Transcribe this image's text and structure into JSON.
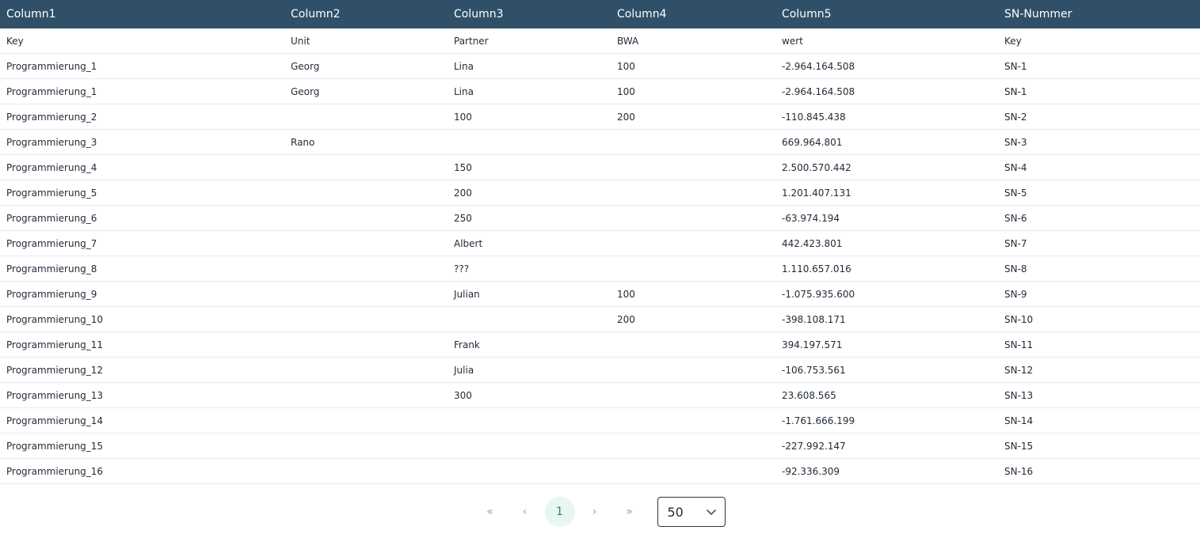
{
  "table": {
    "columns": [
      "Column1",
      "Column2",
      "Column3",
      "Column4",
      "Column5",
      "SN-Nummer"
    ],
    "rows": [
      [
        "Key",
        "Unit",
        "Partner",
        "BWA",
        "wert",
        "Key"
      ],
      [
        "Programmierung_1",
        "Georg",
        "Lina",
        "100",
        "-2.964.164.508",
        "SN-1"
      ],
      [
        "Programmierung_1",
        "Georg",
        "Lina",
        "100",
        "-2.964.164.508",
        "SN-1"
      ],
      [
        "Programmierung_2",
        "",
        "100",
        "200",
        "-110.845.438",
        "SN-2"
      ],
      [
        "Programmierung_3",
        "Rano",
        "",
        "",
        "669.964.801",
        "SN-3"
      ],
      [
        "Programmierung_4",
        "",
        "150",
        "",
        "2.500.570.442",
        "SN-4"
      ],
      [
        "Programmierung_5",
        "",
        "200",
        "",
        "1.201.407.131",
        "SN-5"
      ],
      [
        "Programmierung_6",
        "",
        "250",
        "",
        "-63.974.194",
        "SN-6"
      ],
      [
        "Programmierung_7",
        "",
        "Albert",
        "",
        "442.423.801",
        "SN-7"
      ],
      [
        "Programmierung_8",
        "",
        "???",
        "",
        "1.110.657.016",
        "SN-8"
      ],
      [
        "Programmierung_9",
        "",
        "Julian",
        "100",
        "-1.075.935.600",
        "SN-9"
      ],
      [
        "Programmierung_10",
        "",
        "",
        "200",
        "-398.108.171",
        "SN-10"
      ],
      [
        "Programmierung_11",
        "",
        "Frank",
        "",
        "394.197.571",
        "SN-11"
      ],
      [
        "Programmierung_12",
        "",
        "Julia",
        "",
        "-106.753.561",
        "SN-12"
      ],
      [
        "Programmierung_13",
        "",
        "300",
        "",
        "23.608.565",
        "SN-13"
      ],
      [
        "Programmierung_14",
        "",
        "",
        "",
        "-1.761.666.199",
        "SN-14"
      ],
      [
        "Programmierung_15",
        "",
        "",
        "",
        "-227.992.147",
        "SN-15"
      ],
      [
        "Programmierung_16",
        "",
        "",
        "",
        "-92.336.309",
        "SN-16"
      ]
    ]
  },
  "pagination": {
    "first": "«",
    "prev": "‹",
    "current_page": "1",
    "next": "›",
    "last": "»",
    "page_size": "50"
  }
}
